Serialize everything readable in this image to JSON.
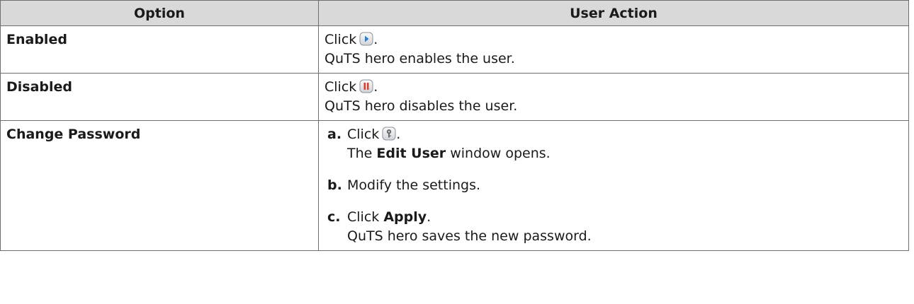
{
  "header": {
    "option": "Option",
    "user_action": "User Action"
  },
  "rows": [
    {
      "option": "Enabled",
      "action_click": "Click",
      "icon": "play-icon",
      "action_after_icon": ".",
      "result": "QuTS hero enables the user."
    },
    {
      "option": "Disabled",
      "action_click": "Click",
      "icon": "pause-icon",
      "action_after_icon": ".",
      "result": "QuTS hero disables the user."
    },
    {
      "option": "Change Password",
      "steps": [
        {
          "mark": "a.",
          "click": "Click",
          "icon": "key-icon",
          "after_icon": ".",
          "result_pre": "The",
          "result_bold": "Edit User",
          "result_post": "window opens."
        },
        {
          "mark": "b.",
          "text": "Modify the settings."
        },
        {
          "mark": "c.",
          "click": "Click",
          "bold": "Apply",
          "after_bold": ".",
          "result": "QuTS hero saves the new password."
        }
      ]
    }
  ],
  "colors": {
    "header_bg": "#d9d9d9",
    "border": "#6e6e6e",
    "play_icon": "#2a7fd4",
    "pause_icon": "#d8412f"
  }
}
